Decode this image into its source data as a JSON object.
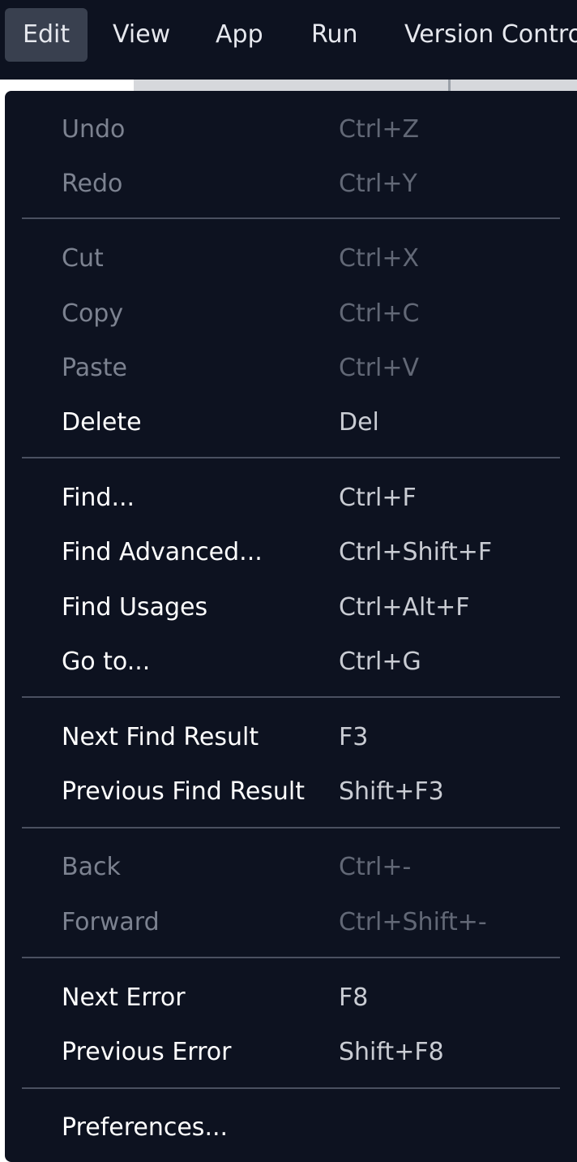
{
  "menubar": {
    "items": [
      {
        "label": "Edit",
        "active": true
      },
      {
        "label": "View",
        "active": false
      },
      {
        "label": "App",
        "active": false
      },
      {
        "label": "Run",
        "active": false
      },
      {
        "label": "Version Contro",
        "active": false
      }
    ]
  },
  "edit_menu": {
    "items": [
      {
        "label": "Undo",
        "shortcut": "Ctrl+Z",
        "enabled": false
      },
      {
        "label": "Redo",
        "shortcut": "Ctrl+Y",
        "enabled": false
      },
      {
        "label": "Cut",
        "shortcut": "Ctrl+X",
        "enabled": false
      },
      {
        "label": "Copy",
        "shortcut": "Ctrl+C",
        "enabled": false
      },
      {
        "label": "Paste",
        "shortcut": "Ctrl+V",
        "enabled": false
      },
      {
        "label": "Delete",
        "shortcut": "Del",
        "enabled": true
      },
      {
        "label": "Find...",
        "shortcut": "Ctrl+F",
        "enabled": true
      },
      {
        "label": "Find Advanced...",
        "shortcut": "Ctrl+Shift+F",
        "enabled": true
      },
      {
        "label": "Find Usages",
        "shortcut": "Ctrl+Alt+F",
        "enabled": true
      },
      {
        "label": "Go to...",
        "shortcut": "Ctrl+G",
        "enabled": true
      },
      {
        "label": "Next Find Result",
        "shortcut": "F3",
        "enabled": true
      },
      {
        "label": "Previous Find Result",
        "shortcut": "Shift+F3",
        "enabled": true
      },
      {
        "label": "Back",
        "shortcut": "Ctrl+-",
        "enabled": false
      },
      {
        "label": "Forward",
        "shortcut": "Ctrl+Shift+-",
        "enabled": false
      },
      {
        "label": "Next Error",
        "shortcut": "F8",
        "enabled": true
      },
      {
        "label": "Previous Error",
        "shortcut": "Shift+F8",
        "enabled": true
      },
      {
        "label": "Preferences...",
        "shortcut": "",
        "enabled": true
      }
    ]
  },
  "colors": {
    "menu_background": "#0d1220",
    "active_menubar_item": "#39404f",
    "enabled_text": "#ffffff",
    "disabled_text": "#7c8290",
    "separator": "#4a5060"
  }
}
